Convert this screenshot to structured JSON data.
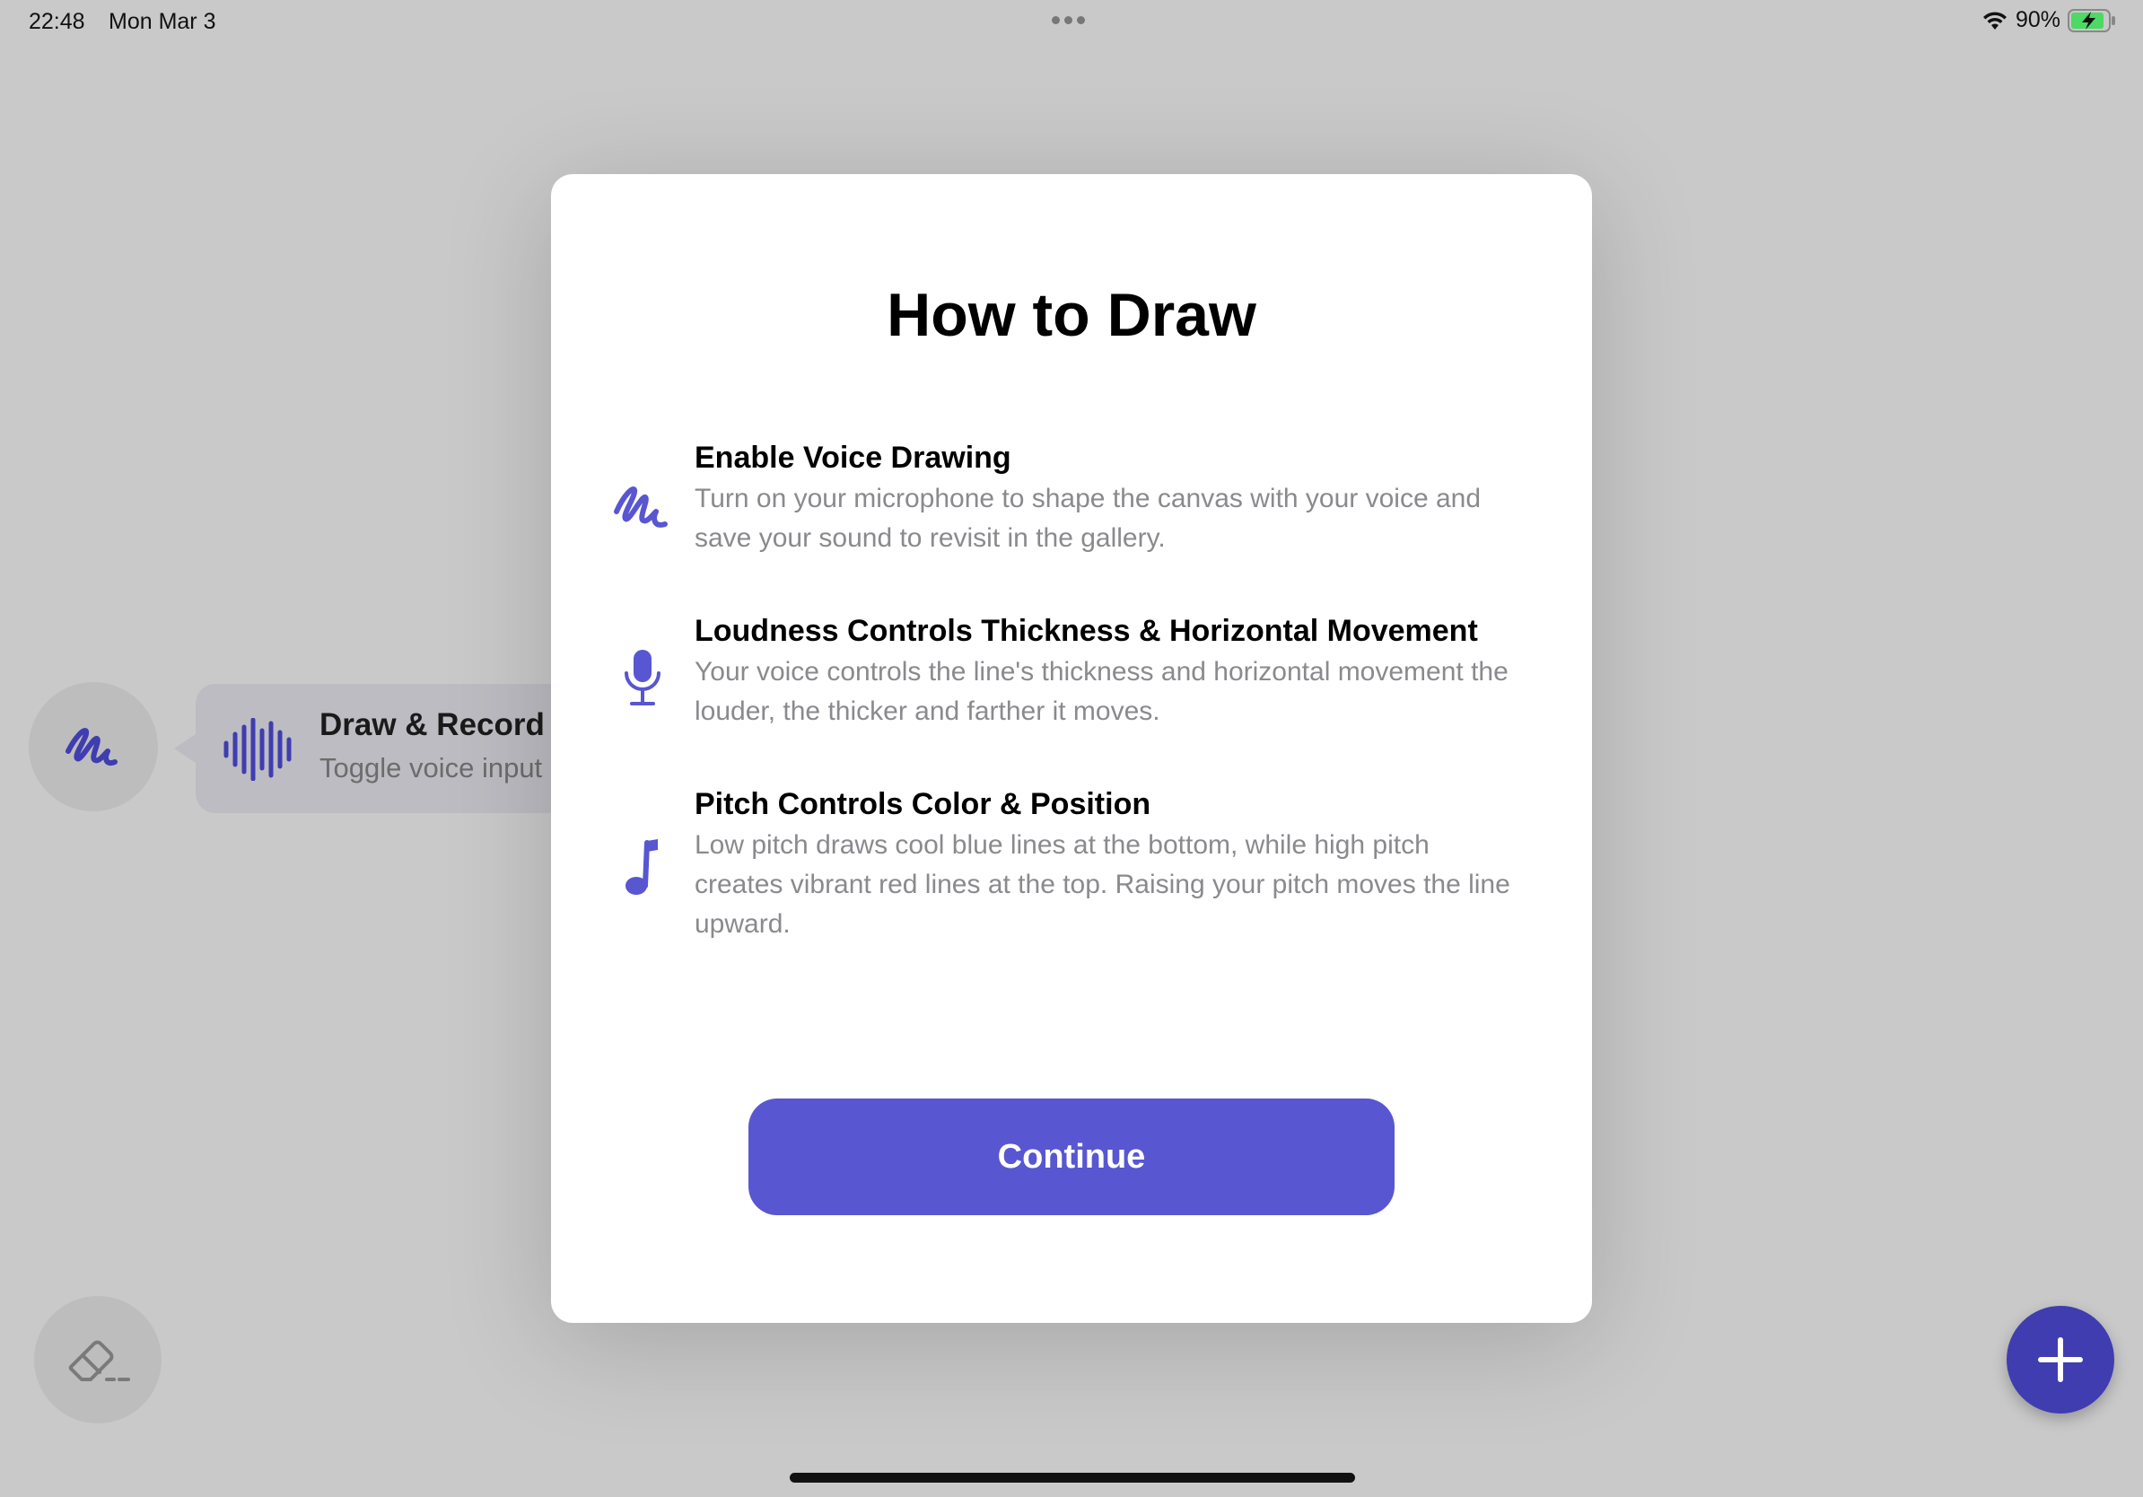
{
  "status_bar": {
    "time": "22:48",
    "date": "Mon Mar 3",
    "battery_percent": "90%",
    "battery_level": 0.9
  },
  "background": {
    "tooltip": {
      "title": "Draw & Record w",
      "subtitle": "Toggle voice input"
    }
  },
  "modal": {
    "title": "How to Draw",
    "features": [
      {
        "icon": "scribble-icon",
        "title": "Enable Voice Drawing",
        "description_lines": [
          "Turn on your microphone to shape the canvas with your voice and",
          "save your sound to revisit in the gallery."
        ]
      },
      {
        "icon": "microphone-icon",
        "title": "Loudness Controls Thickness & Horizontal Movement",
        "description_lines": [
          "Your voice controls the line's thickness and horizontal movement the",
          "louder, the thicker and farther it moves."
        ]
      },
      {
        "icon": "music-note-icon",
        "title": "Pitch Controls Color & Position",
        "description_lines": [
          "Low pitch draws cool blue lines at the bottom, while high pitch",
          "creates vibrant red lines at the top. Raising your pitch moves the line",
          "upward."
        ]
      }
    ],
    "continue_label": "Continue"
  },
  "colors": {
    "accent": "#5856d0",
    "add_button": "#3f3db0",
    "battery_fill": "#4cd964",
    "backdrop": "#c9c9c9"
  }
}
